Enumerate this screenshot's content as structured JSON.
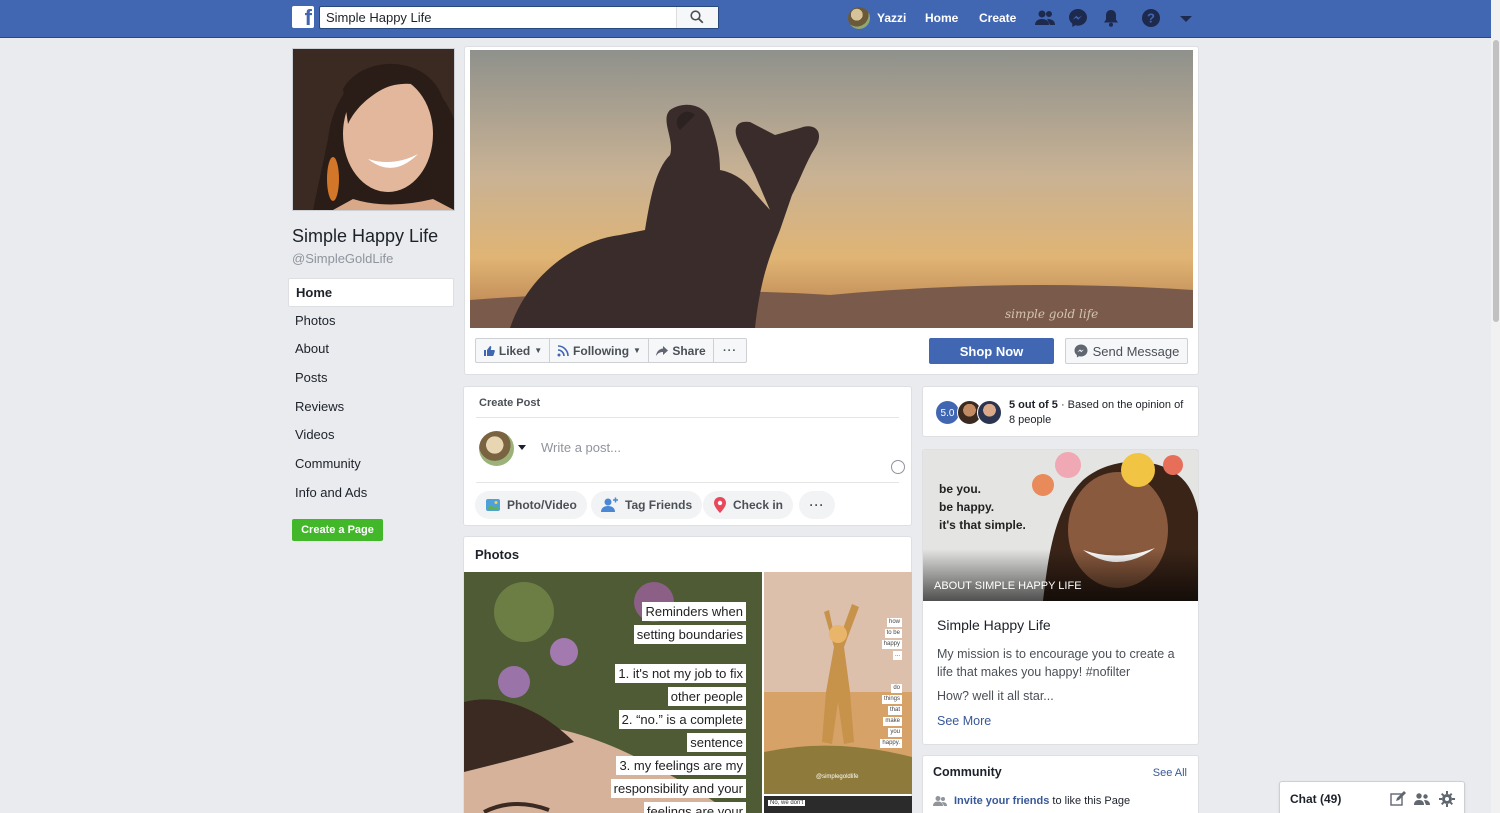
{
  "topbar": {
    "logo_letter": "f",
    "search_value": "Simple Happy Life",
    "user_name": "Yazzi",
    "home_label": "Home",
    "create_label": "Create",
    "icons": [
      "friends-icon",
      "messenger-icon",
      "notifications-icon",
      "help-icon",
      "account-menu-icon"
    ],
    "brand_color": "#4267b2"
  },
  "page": {
    "name": "Simple Happy Life",
    "handle": "@SimpleGoldLife"
  },
  "leftnav": {
    "items": [
      {
        "label": "Home",
        "active": true
      },
      {
        "label": "Photos"
      },
      {
        "label": "About"
      },
      {
        "label": "Posts"
      },
      {
        "label": "Reviews"
      },
      {
        "label": "Videos"
      },
      {
        "label": "Community"
      },
      {
        "label": "Info and Ads"
      }
    ],
    "create_page_label": "Create a Page"
  },
  "cover": {
    "watermark": "simple gold life",
    "buttons": {
      "liked": "Liked",
      "following": "Following",
      "share": "Share",
      "more": "···",
      "shop_now": "Shop Now",
      "send_message": "Send Message"
    }
  },
  "create_post": {
    "title": "Create Post",
    "placeholder": "Write a post...",
    "actions": [
      "Photo/Video",
      "Tag Friends",
      "Check in",
      "···"
    ]
  },
  "photos": {
    "title": "Photos",
    "quote_lines": [
      "Reminders when",
      "setting boundaries",
      "1. it's not my job to fix",
      "other people",
      "2. “no.” is a complete",
      "sentence",
      "3. my feelings are my",
      "responsibility and your",
      "feelings are your"
    ],
    "side_words_top": [
      "how",
      "to be",
      "happy",
      "..."
    ],
    "side_words_bottom": [
      "do",
      "things",
      "that",
      "make",
      "you",
      "happy."
    ],
    "side_credit": "@simplegoldlife",
    "side2_text": "No, we don't"
  },
  "rating": {
    "score": "5.0",
    "strong": "5 out of 5",
    "rest": " · Based on the opinion of 8 people"
  },
  "about": {
    "quote_lines": [
      "be you.",
      "be happy.",
      "it's that simple."
    ],
    "label": "ABOUT SIMPLE HAPPY LIFE",
    "name": "Simple Happy Life",
    "description": "My mission is to encourage you to create a life that makes you happy! #nofilter",
    "description2": "How? well it all star...",
    "see_more": "See More"
  },
  "community": {
    "title": "Community",
    "see_all": "See All",
    "invite_link": "Invite your friends",
    "invite_rest": " to like this Page"
  },
  "chat": {
    "label": "Chat (49)",
    "icons": [
      "compose-icon",
      "group-icon",
      "settings-icon"
    ]
  }
}
